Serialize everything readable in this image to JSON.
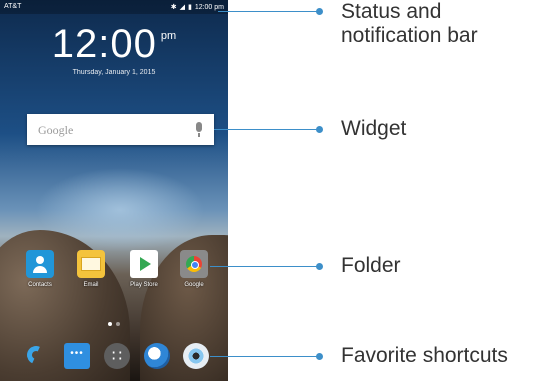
{
  "status_bar": {
    "carrier": "AT&T",
    "time": "12:00 pm",
    "icons": [
      "bluetooth-icon",
      "signal-icon",
      "battery-icon"
    ]
  },
  "clock_widget": {
    "time": "12:00",
    "ampm": "pm",
    "date": "Thursday, January 1, 2015"
  },
  "search_widget": {
    "placeholder": "Google",
    "mic_icon": "mic-icon"
  },
  "apps": [
    {
      "label": "Contacts",
      "icon": "contacts-icon"
    },
    {
      "label": "Email",
      "icon": "email-icon"
    },
    {
      "label": "Play Store",
      "icon": "play-store-icon"
    },
    {
      "label": "Google",
      "icon": "google-folder-icon"
    }
  ],
  "dock": [
    {
      "name": "Phone",
      "icon": "phone-icon"
    },
    {
      "name": "Messaging",
      "icon": "messaging-icon"
    },
    {
      "name": "Apps",
      "icon": "apps-icon"
    },
    {
      "name": "Browser",
      "icon": "browser-icon"
    },
    {
      "name": "Camera",
      "icon": "camera-icon"
    }
  ],
  "callouts": {
    "status_bar": "Status and\nnotification bar",
    "widget": "Widget",
    "folder": "Folder",
    "favorites": "Favorite shortcuts"
  },
  "colors": {
    "callout": "#3d8fc9"
  }
}
